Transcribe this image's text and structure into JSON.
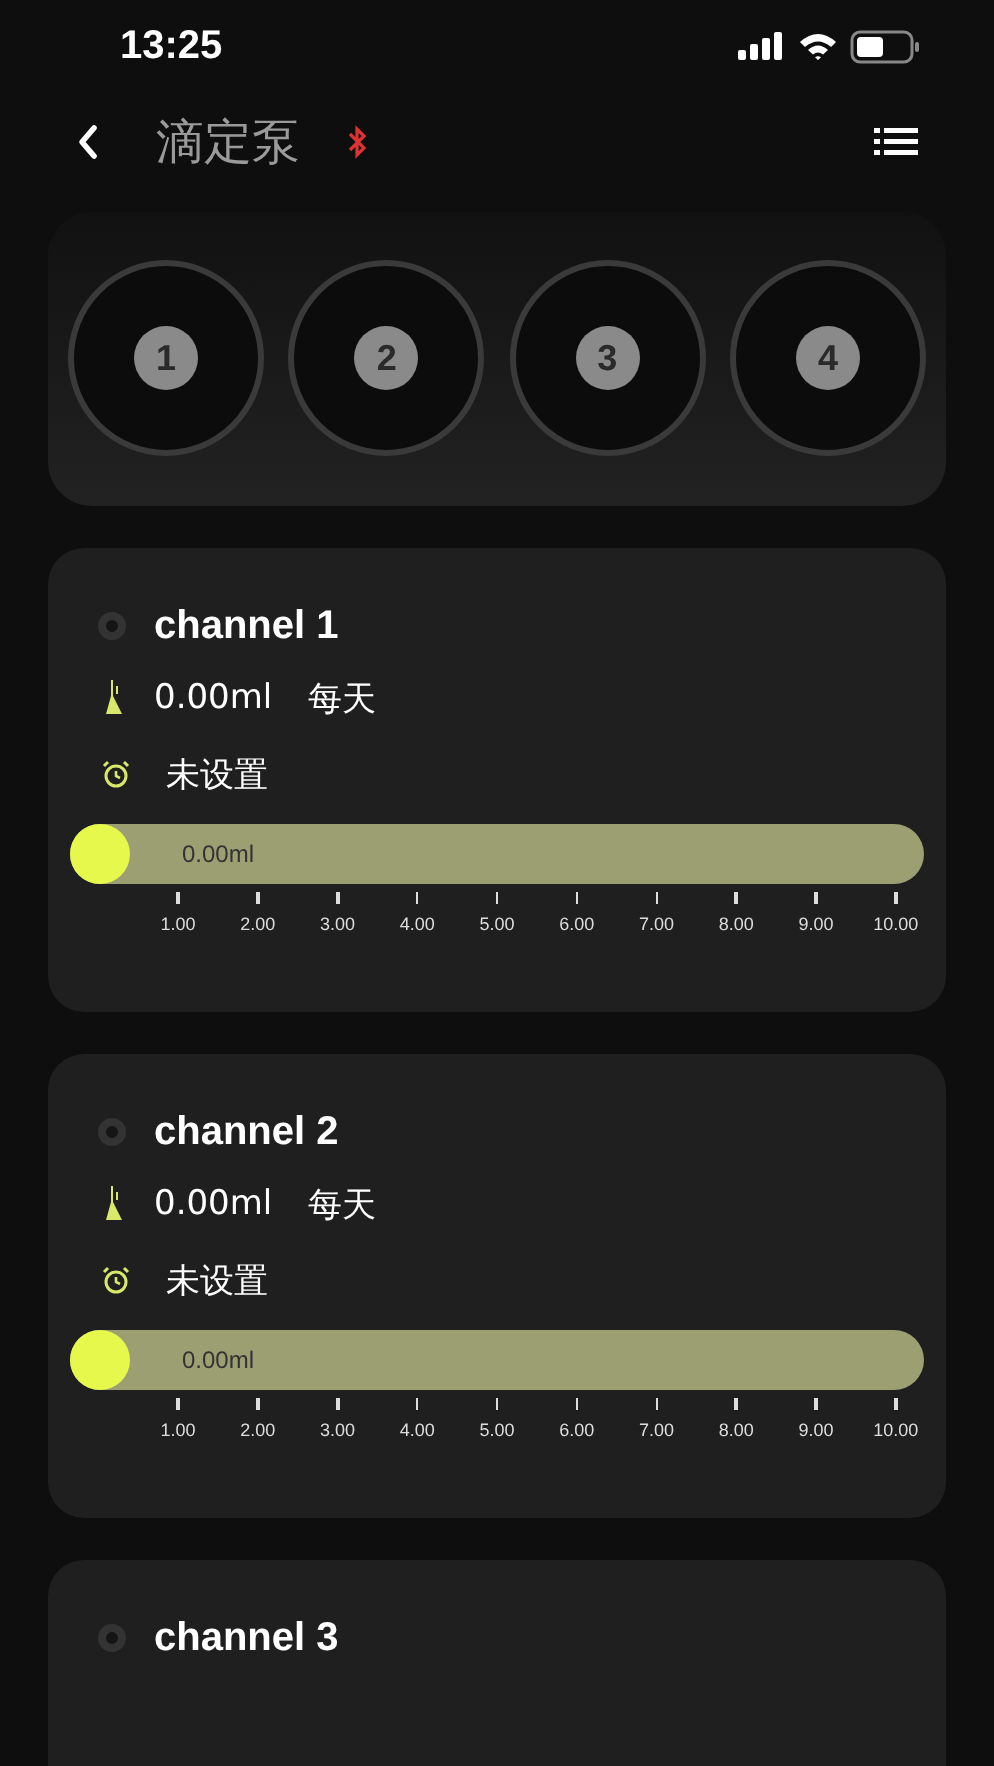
{
  "status_bar": {
    "time": "13:25"
  },
  "header": {
    "title": "滴定泵",
    "bluetooth_connected": false
  },
  "pumps": [
    {
      "label": "1"
    },
    {
      "label": "2"
    },
    {
      "label": "3"
    },
    {
      "label": "4"
    }
  ],
  "channels": [
    {
      "name": "channel 1",
      "dose": "0.00ml",
      "frequency": "每天",
      "schedule": "未设置",
      "slider": {
        "level": 0,
        "reading": "0.00ml",
        "ticks": [
          "1.00",
          "2.00",
          "3.00",
          "4.00",
          "5.00",
          "6.00",
          "7.00",
          "8.00",
          "9.00",
          "10.00"
        ]
      }
    },
    {
      "name": "channel 2",
      "dose": "0.00ml",
      "frequency": "每天",
      "schedule": "未设置",
      "slider": {
        "level": 0,
        "reading": "0.00ml",
        "ticks": [
          "1.00",
          "2.00",
          "3.00",
          "4.00",
          "5.00",
          "6.00",
          "7.00",
          "8.00",
          "9.00",
          "10.00"
        ]
      }
    },
    {
      "name": "channel 3"
    }
  ]
}
